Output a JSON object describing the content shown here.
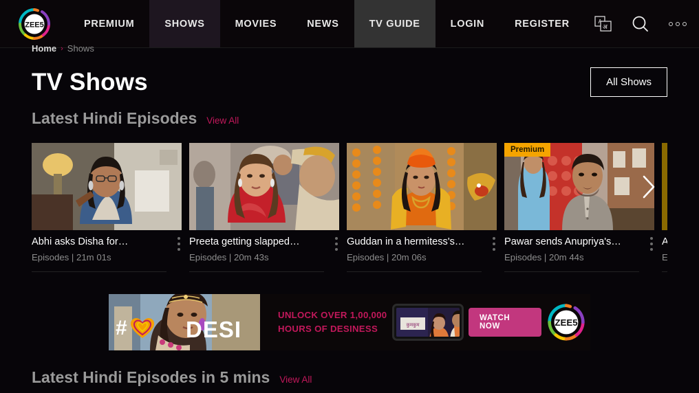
{
  "brand": {
    "logo_text": "ZEE5",
    "accent_pink": "#c2185b",
    "accent_magenta": "#c2377e",
    "premium_amber": "#f5a400"
  },
  "nav": {
    "items": [
      {
        "label": "PREMIUM",
        "state": "normal"
      },
      {
        "label": "SHOWS",
        "state": "active-shows"
      },
      {
        "label": "MOVIES",
        "state": "normal"
      },
      {
        "label": "NEWS",
        "state": "normal"
      },
      {
        "label": "TV GUIDE",
        "state": "active-guide"
      },
      {
        "label": "LOGIN",
        "state": "normal"
      },
      {
        "label": "REGISTER",
        "state": "normal"
      }
    ],
    "icons": [
      {
        "name": "language-translate-icon"
      },
      {
        "name": "search-icon"
      },
      {
        "name": "more-options-icon"
      }
    ]
  },
  "breadcrumb": {
    "home": "Home",
    "separator": "›",
    "current": "Shows"
  },
  "header": {
    "title": "TV Shows",
    "all_shows_label": "All Shows"
  },
  "sections": [
    {
      "title": "Latest Hindi Episodes",
      "view_all": "View All",
      "cards": [
        {
          "title": "Abhi asks Disha for…",
          "meta": "Episodes | 21m 01s",
          "premium": false,
          "badge": ""
        },
        {
          "title": "Preeta getting slapped…",
          "meta": "Episodes | 20m 43s",
          "premium": false,
          "badge": ""
        },
        {
          "title": "Guddan in a hermitess's…",
          "meta": "Episodes | 20m 06s",
          "premium": false,
          "badge": ""
        },
        {
          "title": "Pawar sends Anupriya's…",
          "meta": "Episodes | 20m 44s",
          "premium": true,
          "badge": "Premium"
        },
        {
          "title": "Asmita",
          "meta": "Episode",
          "premium": false,
          "badge": ""
        }
      ]
    },
    {
      "title": "Latest Hindi Episodes in 5 mins",
      "view_all": "View All"
    }
  ],
  "banner": {
    "hash_symbol": "#",
    "word": "DESI",
    "line1": "UNLOCK OVER 1,00,000",
    "line2": "HOURS OF DESINESS",
    "cta": "WATCH NOW",
    "logo_text": "ZEE5"
  }
}
